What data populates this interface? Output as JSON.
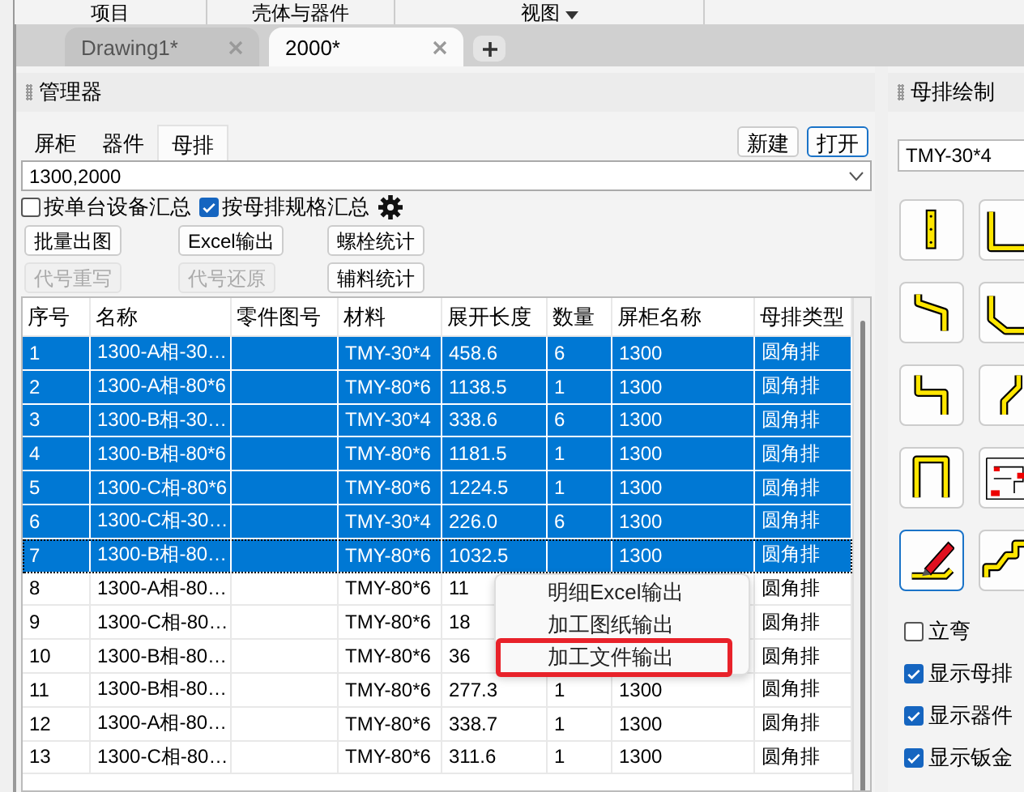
{
  "menu_bar": [
    {
      "label": "项目",
      "caret": false
    },
    {
      "label": "壳体与器件",
      "caret": false
    },
    {
      "label": "视图",
      "caret": true
    }
  ],
  "document_tabs": [
    {
      "label": "Drawing1*",
      "selected": false
    },
    {
      "label": "2000*",
      "selected": true
    }
  ],
  "manager": {
    "title": "管理器",
    "tabs": [
      {
        "label": "屏柜",
        "selected": false
      },
      {
        "label": "器件",
        "selected": false
      },
      {
        "label": "母排",
        "selected": true
      }
    ],
    "actions": [
      {
        "label": "新建",
        "focused": false
      },
      {
        "label": "打开",
        "focused": true
      }
    ],
    "selector": {
      "value": "1300,2000"
    },
    "options": [
      {
        "label": "按单台设备汇总",
        "checked": false
      },
      {
        "label": "按母排规格汇总",
        "checked": true
      }
    ],
    "buttons": [
      {
        "label": "批量出图",
        "disabled": false
      },
      {
        "label": "Excel输出",
        "disabled": false
      },
      {
        "label": "螺栓统计",
        "disabled": false
      },
      {
        "label": "代号重写",
        "disabled": true
      },
      {
        "label": "代号还原",
        "disabled": true
      },
      {
        "label": "辅料统计",
        "disabled": false
      }
    ],
    "table": {
      "columns": [
        "序号",
        "名称",
        "零件图号",
        "材料",
        "展开长度",
        "数量",
        "屏柜名称",
        "母排类型"
      ],
      "rows": [
        {
          "selected": true,
          "focused": false,
          "cells": [
            "1",
            "1300-A相-30…",
            "",
            "TMY-30*4",
            "458.6",
            "6",
            "1300",
            "圆角排"
          ]
        },
        {
          "selected": true,
          "focused": false,
          "cells": [
            "2",
            "1300-A相-80*6",
            "",
            "TMY-80*6",
            "1138.5",
            "1",
            "1300",
            "圆角排"
          ]
        },
        {
          "selected": true,
          "focused": false,
          "cells": [
            "3",
            "1300-B相-30…",
            "",
            "TMY-30*4",
            "338.6",
            "6",
            "1300",
            "圆角排"
          ]
        },
        {
          "selected": true,
          "focused": false,
          "cells": [
            "4",
            "1300-B相-80*6",
            "",
            "TMY-80*6",
            "1181.5",
            "1",
            "1300",
            "圆角排"
          ]
        },
        {
          "selected": true,
          "focused": false,
          "cells": [
            "5",
            "1300-C相-80*6",
            "",
            "TMY-80*6",
            "1224.5",
            "1",
            "1300",
            "圆角排"
          ]
        },
        {
          "selected": true,
          "focused": false,
          "cells": [
            "6",
            "1300-C相-30…",
            "",
            "TMY-30*4",
            "226.0",
            "6",
            "1300",
            "圆角排"
          ]
        },
        {
          "selected": true,
          "focused": true,
          "cells": [
            "7",
            "1300-B相-80…",
            "",
            "TMY-80*6",
            "1032.5",
            "",
            "1300",
            "圆角排"
          ]
        },
        {
          "selected": false,
          "focused": false,
          "cells": [
            "8",
            "1300-A相-80…",
            "",
            "TMY-80*6",
            "11",
            "",
            "",
            "圆角排"
          ]
        },
        {
          "selected": false,
          "focused": false,
          "cells": [
            "9",
            "1300-C相-80…",
            "",
            "TMY-80*6",
            "18",
            "",
            "",
            "圆角排"
          ]
        },
        {
          "selected": false,
          "focused": false,
          "cells": [
            "10",
            "1300-B相-80…",
            "",
            "TMY-80*6",
            "36",
            "",
            "",
            "圆角排"
          ]
        },
        {
          "selected": false,
          "focused": false,
          "cells": [
            "11",
            "1300-B相-80…",
            "",
            "TMY-80*6",
            "277.3",
            "1",
            "1300",
            "圆角排"
          ]
        },
        {
          "selected": false,
          "focused": false,
          "cells": [
            "12",
            "1300-A相-80…",
            "",
            "TMY-80*6",
            "338.7",
            "1",
            "1300",
            "圆角排"
          ]
        },
        {
          "selected": false,
          "focused": false,
          "cells": [
            "13",
            "1300-C相-80…",
            "",
            "TMY-80*6",
            "311.6",
            "1",
            "1300",
            "圆角排"
          ]
        }
      ]
    }
  },
  "context_menu": {
    "items": [
      {
        "label": "明细Excel输出",
        "highlighted": false
      },
      {
        "label": "加工图纸输出",
        "highlighted": false
      },
      {
        "label": "加工文件输出",
        "highlighted": true
      }
    ]
  },
  "busbar_panel": {
    "title": "母排绘制",
    "material": {
      "value": "TMY-30*4"
    },
    "tools": [
      {
        "kind": "bar",
        "selected": false
      },
      {
        "kind": "l-bend",
        "selected": false
      },
      {
        "kind": "offset",
        "selected": false
      },
      {
        "kind": "chamfer",
        "selected": false
      },
      {
        "kind": "step",
        "selected": false
      },
      {
        "kind": "slant",
        "selected": false
      },
      {
        "kind": "u-bend",
        "selected": false
      },
      {
        "kind": "diagram",
        "selected": false
      },
      {
        "kind": "pencil",
        "selected": true
      },
      {
        "kind": "stairs",
        "selected": false
      }
    ],
    "options": [
      {
        "label": "立弯",
        "checked": false
      },
      {
        "label": "显示母排",
        "checked": true
      },
      {
        "label": "显示器件",
        "checked": true
      },
      {
        "label": "显示钣金",
        "checked": true
      }
    ]
  }
}
